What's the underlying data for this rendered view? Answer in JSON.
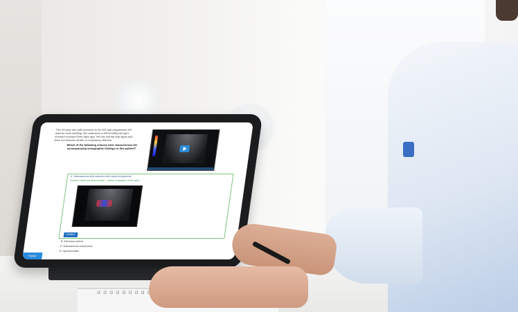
{
  "tablet_screen": {
    "question_stem": "This 40-year-old male presents to the ED with progressive left anterior neck swelling. He underwent a left hemithyroid right remnant excision three days ago. He has normal vital signs and does not endorse stridor or respiratory distress.",
    "question_prompt": "Which of the following choices best characterizes the accompanying sonographic findings in this patient?",
    "option_a": "A.    Subcutaneous fluid collection with mixed echogenicity",
    "correct_feedback": "Correct: These are echo-central ... further evaluation of the neck ...",
    "submit_label": "SUBMIT",
    "option_b": "B.    Soft tissue edema",
    "option_c": "C.    Subcutaneous emphysema",
    "option_d": "D.    Hypothyroidism",
    "explain_label": "Explain"
  },
  "colors": {
    "accent_blue": "#2c8cdc",
    "correct_green": "#2e9b4d",
    "answer_border": "#7cc47c"
  }
}
